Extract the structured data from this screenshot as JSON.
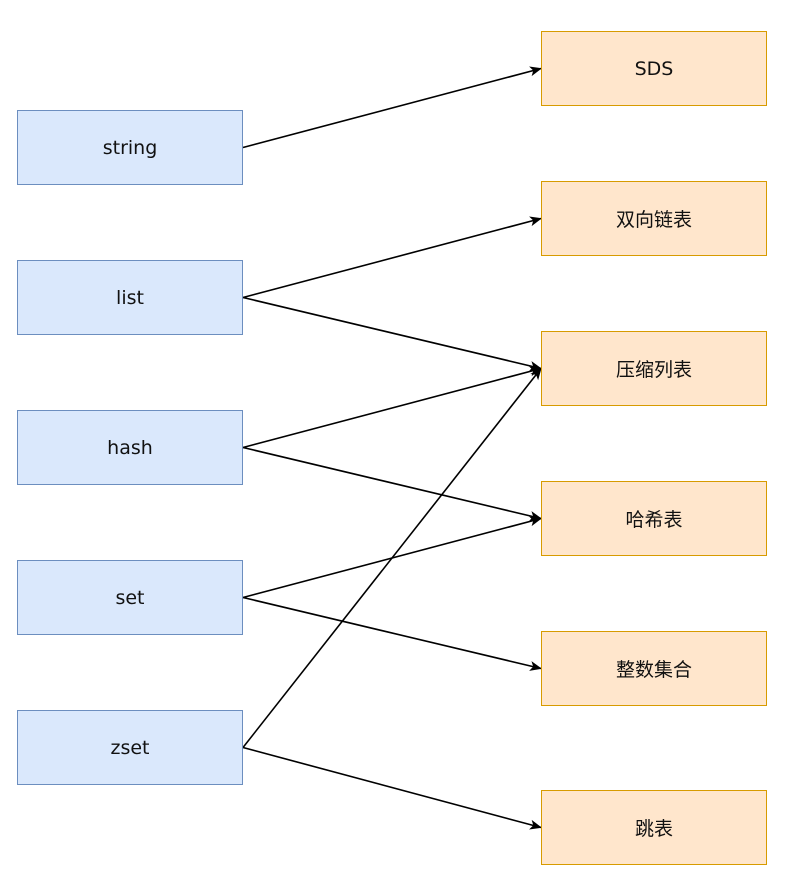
{
  "nodes": {
    "string": "string",
    "list": "list",
    "hash": "hash",
    "set": "set",
    "zset": "zset",
    "sds": "SDS",
    "linkedlist": "双向链表",
    "ziplist": "压缩列表",
    "hashtable": "哈希表",
    "intset": "整数集合",
    "skiplist": "跳表"
  },
  "edges": [
    {
      "from": "string",
      "to": "sds"
    },
    {
      "from": "list",
      "to": "linkedlist"
    },
    {
      "from": "list",
      "to": "ziplist"
    },
    {
      "from": "hash",
      "to": "ziplist"
    },
    {
      "from": "hash",
      "to": "hashtable"
    },
    {
      "from": "set",
      "to": "hashtable"
    },
    {
      "from": "set",
      "to": "intset"
    },
    {
      "from": "zset",
      "to": "ziplist"
    },
    {
      "from": "zset",
      "to": "skiplist"
    }
  ],
  "colors": {
    "left_fill": "#dae8fc",
    "left_stroke": "#6c8ebf",
    "right_fill": "#ffe6cc",
    "right_stroke": "#d79b00",
    "edge": "#000000"
  }
}
